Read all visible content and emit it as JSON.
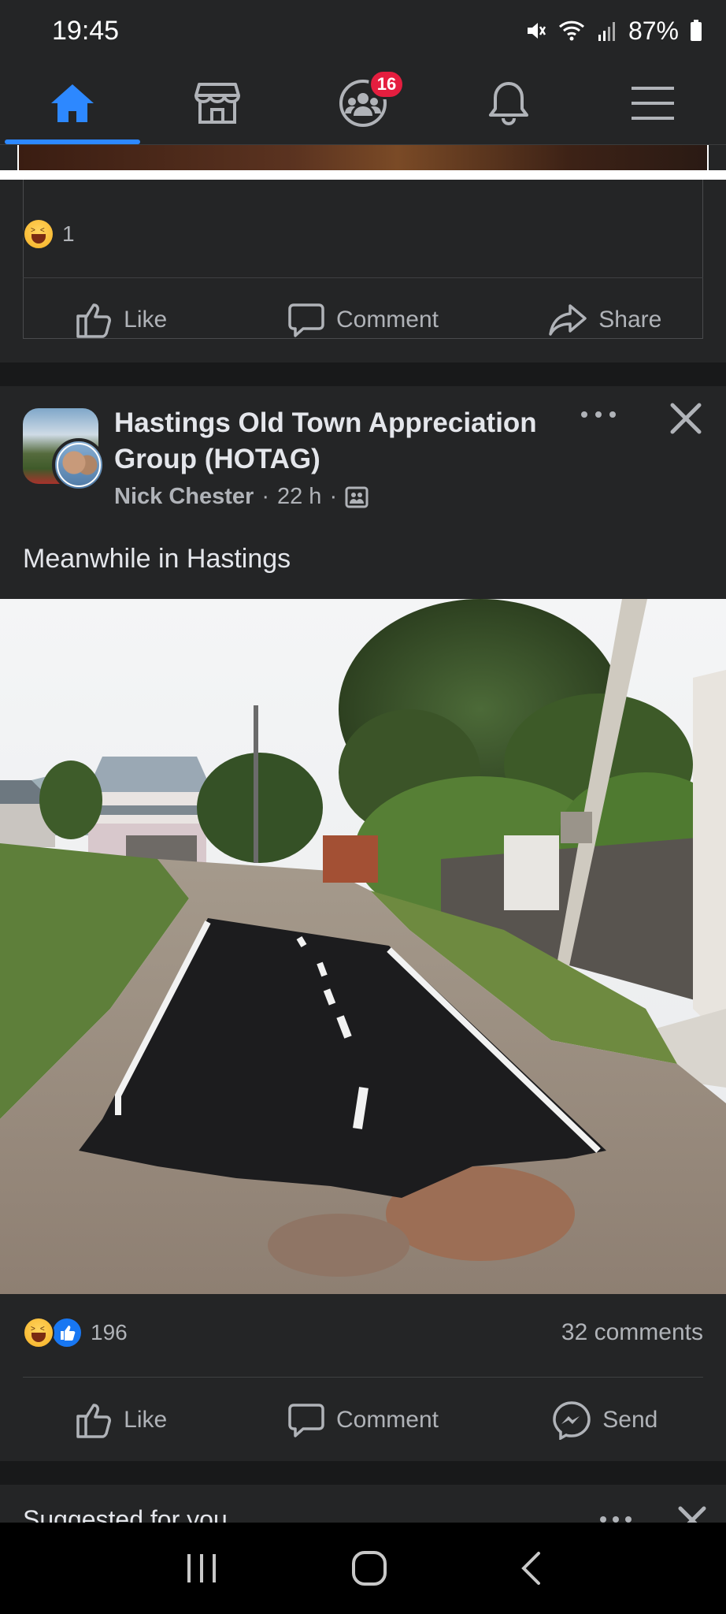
{
  "status": {
    "time": "19:45",
    "battery": "87%"
  },
  "nav": {
    "tabs": [
      "home",
      "marketplace",
      "groups",
      "notifications",
      "menu"
    ],
    "groups_badge": "16",
    "active_color": "#2d88ff"
  },
  "prev_post": {
    "reaction_count": "1",
    "actions": {
      "like": "Like",
      "comment": "Comment",
      "share": "Share"
    }
  },
  "post": {
    "group_name": "Hastings Old Town Appreciation Group (HOTAG)",
    "author": "Nick Chester",
    "time": "22 h",
    "text": "Meanwhile in Hastings",
    "reaction_count": "196",
    "comments": "32 comments",
    "actions": {
      "like": "Like",
      "comment": "Comment",
      "send": "Send"
    }
  },
  "suggested": {
    "title": "Suggested for you"
  },
  "colors": {
    "bg": "#18191a",
    "card": "#242526",
    "text": "#e4e6eb",
    "muted": "#b0b3b8",
    "badge": "#e41e3f"
  }
}
